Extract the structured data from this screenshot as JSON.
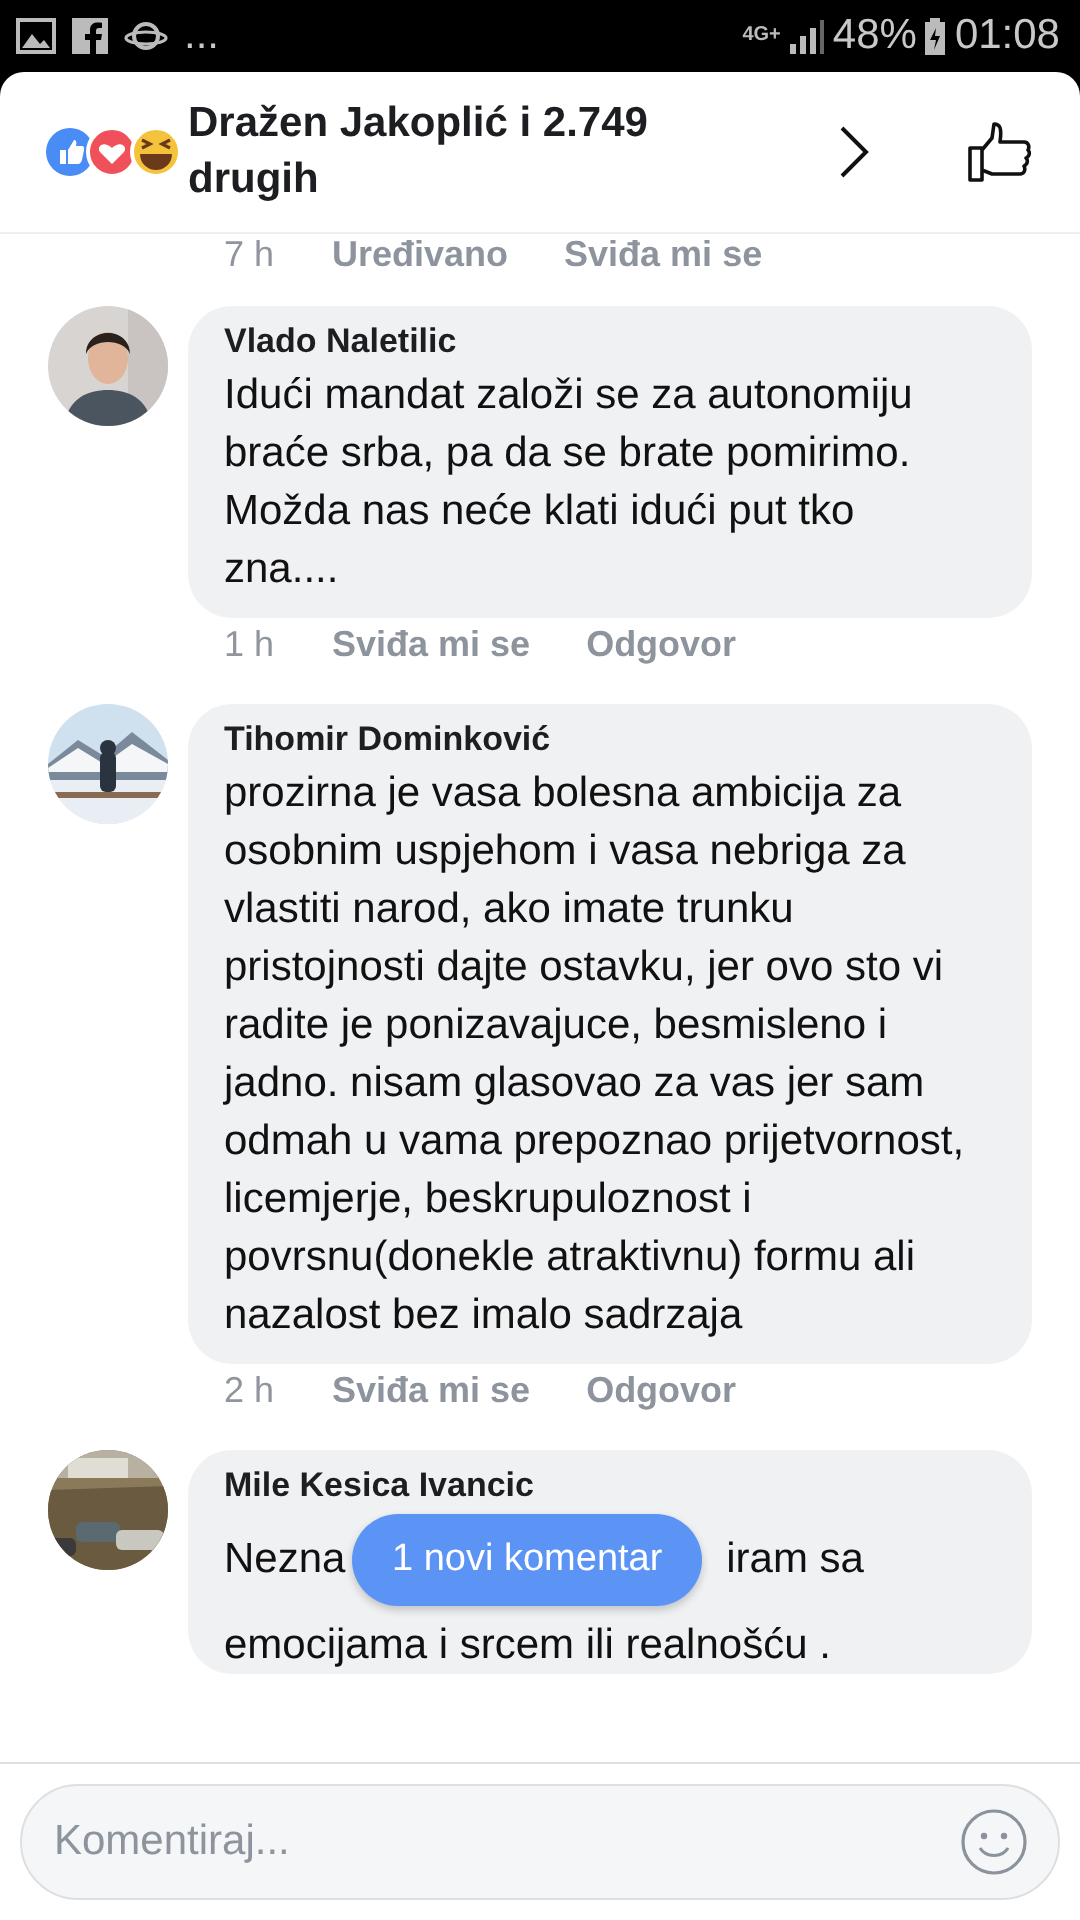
{
  "status_bar": {
    "left_more": "...",
    "network": "4G+",
    "battery": "48%",
    "time": "01:08"
  },
  "header": {
    "reactions": "Dražen Jakoplić i 2.749 drugih"
  },
  "top_meta": {
    "time": "7 h",
    "actions": [
      "Uređivano",
      "Sviđa mi se"
    ]
  },
  "comments": [
    {
      "name": "Vlado Naletilic",
      "text": "Idući mandat založi se za autonomiju braće srba, pa da se brate pomirimo. Možda nas neće klati idući put tko zna....",
      "time": "1 h",
      "actions": [
        "Sviđa mi se",
        "Odgovor"
      ]
    },
    {
      "name": "Tihomir Dominković",
      "text": "prozirna je vasa bolesna ambicija za osobnim uspjehom i vasa nebriga za vlastiti narod, ako imate trunku pristojnosti dajte ostavku, jer ovo sto vi radite je ponizavajuce, besmisleno i jadno. nisam glasovao za vas jer sam odmah u vama prepoznao prijetvornost, licemjerje, beskrupuloznost i povrsnu(donekle atraktivnu) formu ali nazalost bez imalo sadrzaja",
      "time": "2 h",
      "actions": [
        "Sviđa mi se",
        "Odgovor"
      ]
    }
  ],
  "partial_comment": {
    "name": "Mile Kesica Ivancic",
    "line1_start": "Nezna",
    "line1_end": "iram sa",
    "line2": "emocijama i srcem ili realnošću ."
  },
  "new_comments_pill": "1 novi komentar",
  "composer": {
    "placeholder": "Komentiraj..."
  }
}
